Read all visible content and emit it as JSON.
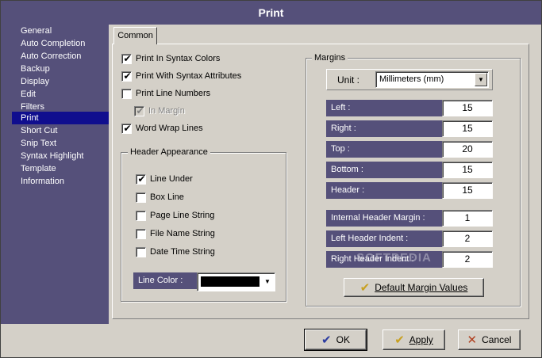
{
  "window": {
    "title": "Print"
  },
  "sidebar": {
    "items": [
      {
        "label": "General"
      },
      {
        "label": "Auto Completion"
      },
      {
        "label": "Auto Correction"
      },
      {
        "label": "Backup"
      },
      {
        "label": "Display"
      },
      {
        "label": "Edit"
      },
      {
        "label": "Filters"
      },
      {
        "label": "Print",
        "selected": true
      },
      {
        "label": "Short Cut"
      },
      {
        "label": "Snip Text"
      },
      {
        "label": "Syntax Highlight"
      },
      {
        "label": "Template"
      },
      {
        "label": "Information"
      }
    ]
  },
  "tabs": [
    {
      "label": "Common"
    }
  ],
  "print_options": [
    {
      "label": "Print In Syntax Colors",
      "checked": true
    },
    {
      "label": "Print With Syntax Attributes",
      "checked": true
    },
    {
      "label": "Print Line Numbers",
      "checked": false
    },
    {
      "label": "In Margin",
      "checked": true,
      "disabled": true
    },
    {
      "label": "Word Wrap Lines",
      "checked": true
    }
  ],
  "header_appearance": {
    "title": "Header Appearance",
    "options": [
      {
        "label": "Line Under",
        "checked": true
      },
      {
        "label": "Box Line",
        "checked": false
      },
      {
        "label": "Page Line String",
        "checked": false
      },
      {
        "label": "File Name String",
        "checked": false
      },
      {
        "label": "Date Time String",
        "checked": false
      }
    ],
    "line_color_label": "Line Color :",
    "line_color": "#000000"
  },
  "margins": {
    "title": "Margins",
    "unit_label": "Unit :",
    "unit_value": "Millimeters (mm)",
    "fields": [
      {
        "label": "Left :",
        "value": "15"
      },
      {
        "label": "Right :",
        "value": "15"
      },
      {
        "label": "Top :",
        "value": "20"
      },
      {
        "label": "Bottom :",
        "value": "15"
      },
      {
        "label": "Header :",
        "value": "15"
      }
    ],
    "header_fields": [
      {
        "label": "Internal Header Margin :",
        "value": "1"
      },
      {
        "label": "Left Header Indent :",
        "value": "2"
      },
      {
        "label": "Right Header Indent :",
        "value": "2"
      }
    ],
    "default_button": "Default Margin Values"
  },
  "buttons": {
    "ok": "OK",
    "apply": "Apply",
    "cancel": "Cancel"
  },
  "watermark": "SOFTPEDIA",
  "colors": {
    "accent": "#55507a",
    "selection": "#100e8e",
    "face": "#d4d0c8"
  }
}
